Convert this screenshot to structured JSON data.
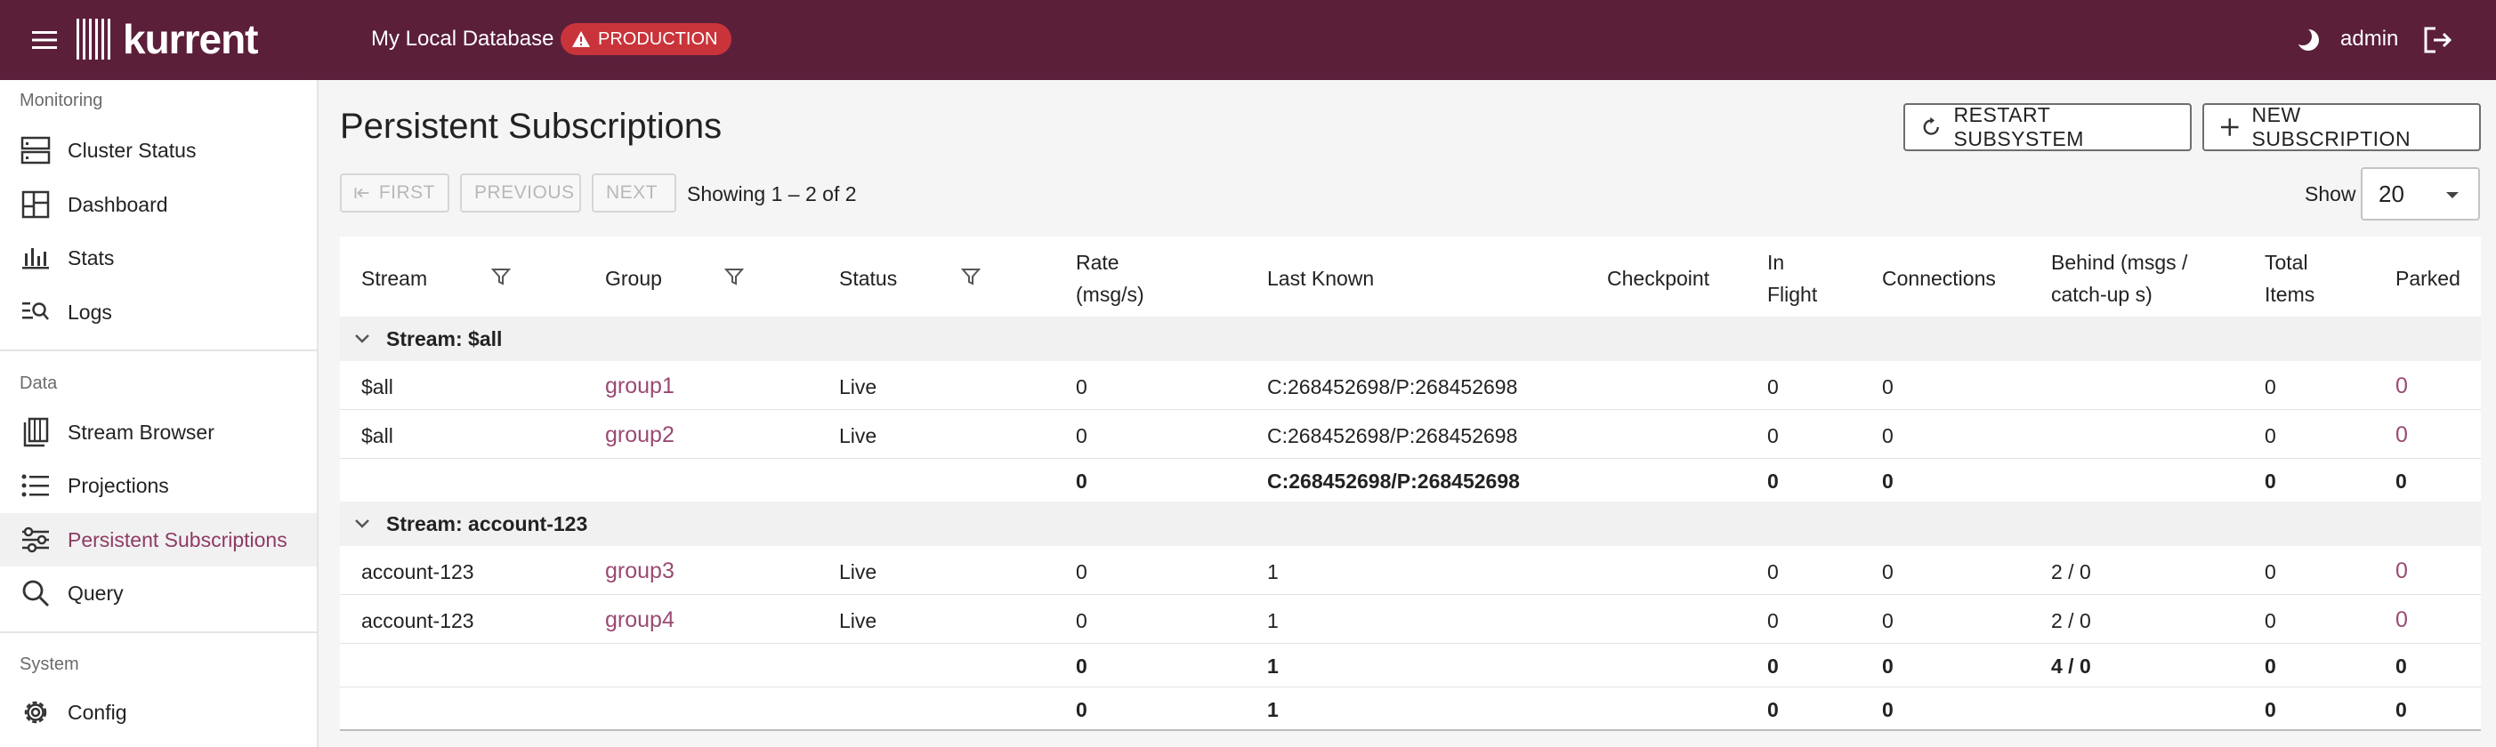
{
  "header": {
    "logo_text": "kurrent",
    "database_name": "My Local Database",
    "environment_badge": "PRODUCTION",
    "user": "admin",
    "colors": {
      "brand": "#5b1f3a",
      "badge": "#c9343b",
      "accent": "#8f3a63"
    }
  },
  "sidebar": {
    "sections": [
      {
        "title": "Monitoring",
        "items": [
          {
            "label": "Cluster Status",
            "icon": "server-icon"
          },
          {
            "label": "Dashboard",
            "icon": "dashboard-icon"
          },
          {
            "label": "Stats",
            "icon": "bar-chart-icon"
          },
          {
            "label": "Logs",
            "icon": "log-search-icon"
          }
        ]
      },
      {
        "title": "Data",
        "items": [
          {
            "label": "Stream Browser",
            "icon": "stream-browser-icon"
          },
          {
            "label": "Projections",
            "icon": "list-icon"
          },
          {
            "label": "Persistent Subscriptions",
            "icon": "tune-icon",
            "active": true
          },
          {
            "label": "Query",
            "icon": "search-icon"
          }
        ]
      },
      {
        "title": "System",
        "items": [
          {
            "label": "Config",
            "icon": "gear-icon"
          }
        ]
      }
    ]
  },
  "page": {
    "title": "Persistent Subscriptions",
    "restart_button": "RESTART SUBSYSTEM",
    "new_button": "NEW SUBSCRIPTION"
  },
  "pager": {
    "first": "FIRST",
    "previous": "PREVIOUS",
    "next": "NEXT",
    "showing": "Showing 1 – 2 of 2",
    "show_label": "Show",
    "page_size": "20"
  },
  "table": {
    "columns": {
      "stream": "Stream",
      "group": "Group",
      "status": "Status",
      "rate_1": "Rate",
      "rate_2": "(msg/s)",
      "last_known": "Last Known",
      "checkpoint": "Checkpoint",
      "in_flight_1": "In",
      "in_flight_2": "Flight",
      "connections": "Connections",
      "behind_1": "Behind (msgs /",
      "behind_2": "catch-up s)",
      "total_1": "Total",
      "total_2": "Items",
      "parked": "Parked"
    },
    "groups": [
      {
        "title": "Stream: $all",
        "rows": [
          {
            "stream": "$all",
            "group": "group1",
            "status": "Live",
            "rate": "0",
            "last_known": "C:268452698/P:268452698",
            "checkpoint": "",
            "in_flight": "0",
            "connections": "0",
            "behind": "",
            "total": "0",
            "parked": "0"
          },
          {
            "stream": "$all",
            "group": "group2",
            "status": "Live",
            "rate": "0",
            "last_known": "C:268452698/P:268452698",
            "checkpoint": "",
            "in_flight": "0",
            "connections": "0",
            "behind": "",
            "total": "0",
            "parked": "0"
          }
        ],
        "totals": {
          "rate": "0",
          "last_known": "C:268452698/P:268452698",
          "in_flight": "0",
          "connections": "0",
          "behind": "",
          "total": "0",
          "parked": "0"
        }
      },
      {
        "title": "Stream: account-123",
        "rows": [
          {
            "stream": "account-123",
            "group": "group3",
            "status": "Live",
            "rate": "0",
            "last_known": "1",
            "checkpoint": "",
            "in_flight": "0",
            "connections": "0",
            "behind": "2 / 0",
            "total": "0",
            "parked": "0"
          },
          {
            "stream": "account-123",
            "group": "group4",
            "status": "Live",
            "rate": "0",
            "last_known": "1",
            "checkpoint": "",
            "in_flight": "0",
            "connections": "0",
            "behind": "2 / 0",
            "total": "0",
            "parked": "0"
          }
        ],
        "totals": {
          "rate": "0",
          "last_known": "1",
          "in_flight": "0",
          "connections": "0",
          "behind": "4 / 0",
          "total": "0",
          "parked": "0"
        }
      }
    ],
    "grand_total": {
      "rate": "0",
      "last_known": "1",
      "in_flight": "0",
      "connections": "0",
      "behind": "",
      "total": "0",
      "parked": "0"
    }
  }
}
